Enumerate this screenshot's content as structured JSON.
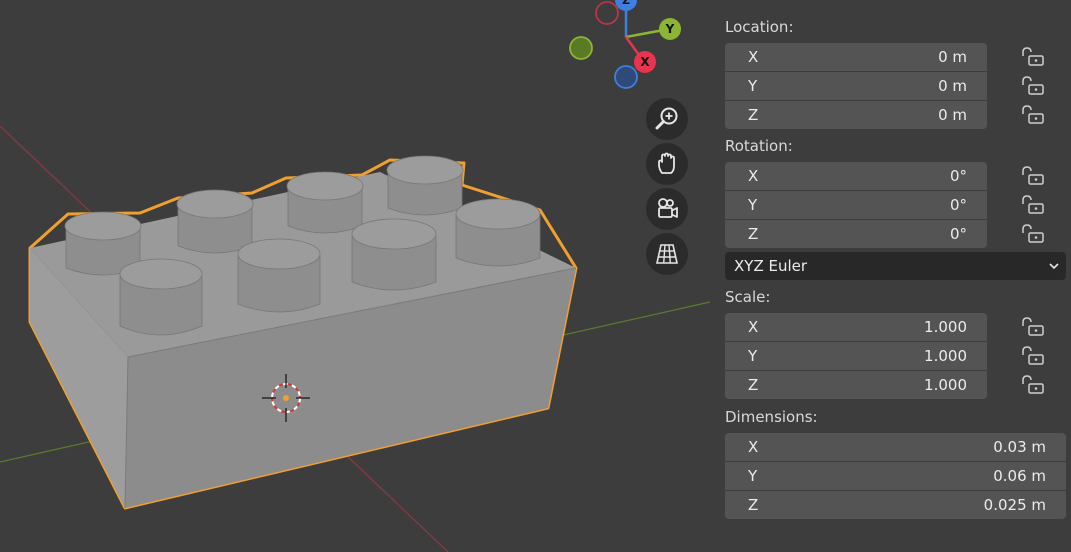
{
  "gizmo": {
    "z_label": "Z",
    "y_label": "Y",
    "x_label": "X",
    "colors": {
      "x": "#e8344e",
      "y": "#8bb634",
      "z": "#3f7fe0"
    }
  },
  "nav": {
    "icons": [
      "zoom-icon",
      "hand-pan-icon",
      "camera-view-icon",
      "grid-ortho-icon"
    ]
  },
  "location": {
    "label": "Location:",
    "x_axis": "X",
    "x": "0 m",
    "y_axis": "Y",
    "y": "0 m",
    "z_axis": "Z",
    "z": "0 m"
  },
  "rotation": {
    "label": "Rotation:",
    "x_axis": "X",
    "x": "0°",
    "y_axis": "Y",
    "y": "0°",
    "z_axis": "Z",
    "z": "0°",
    "mode": "XYZ Euler"
  },
  "scale": {
    "label": "Scale:",
    "x_axis": "X",
    "x": "1.000",
    "y_axis": "Y",
    "y": "1.000",
    "z_axis": "Z",
    "z": "1.000"
  },
  "dimensions": {
    "label": "Dimensions:",
    "x_axis": "X",
    "x": "0.03 m",
    "y_axis": "Y",
    "y": "0.06 m",
    "z_axis": "Z",
    "z": "0.025 m"
  },
  "theme": {
    "background": "#3d3d3d",
    "field": "#545454",
    "selection_outline": "#f0a030"
  }
}
